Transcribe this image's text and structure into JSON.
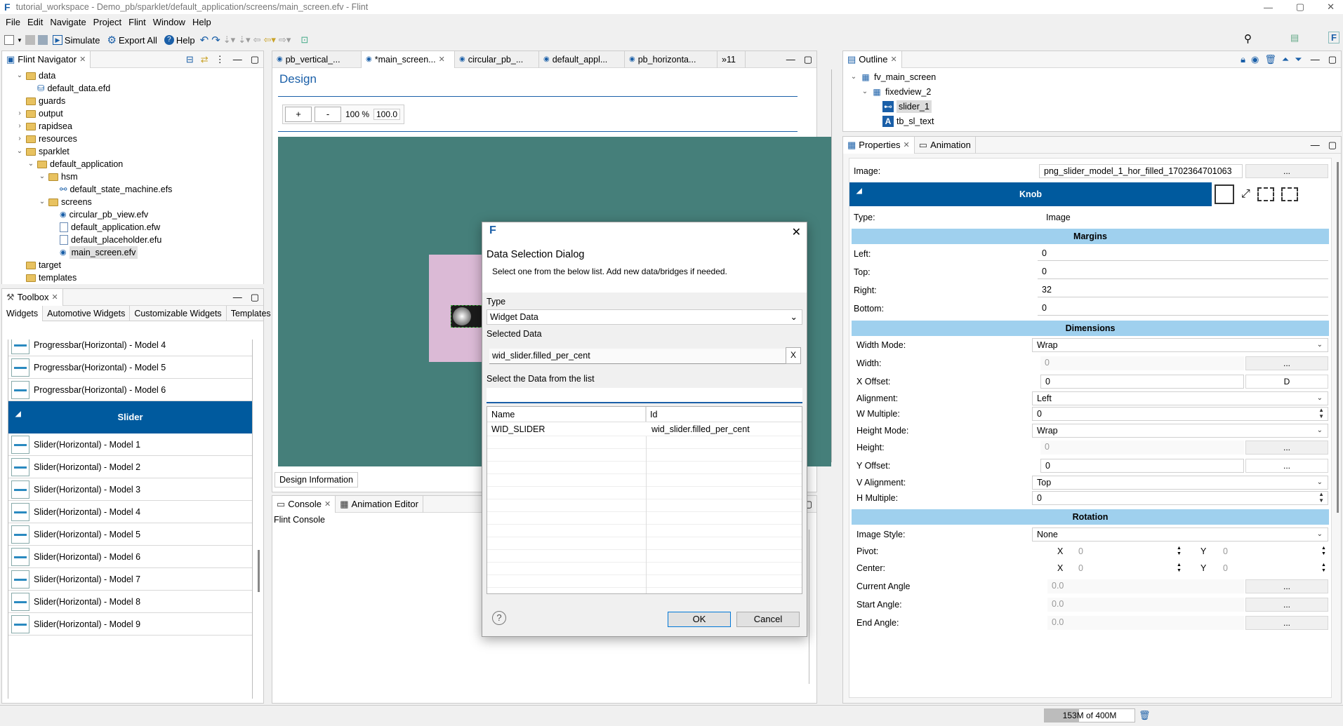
{
  "window": {
    "title": "tutorial_workspace - Demo_pb/sparklet/default_application/screens/main_screen.efv - Flint"
  },
  "menu": [
    "File",
    "Edit",
    "Navigate",
    "Project",
    "Flint",
    "Window",
    "Help"
  ],
  "toolbar": {
    "simulate": "Simulate",
    "export_all": "Export All",
    "help": "Help"
  },
  "navigator": {
    "title": "Flint Navigator",
    "items": [
      {
        "label": "data",
        "level": 1,
        "kind": "folder",
        "tw": "v"
      },
      {
        "label": "default_data.efd",
        "level": 2,
        "kind": "db",
        "tw": ""
      },
      {
        "label": "guards",
        "level": 1,
        "kind": "folder",
        "tw": ""
      },
      {
        "label": "output",
        "level": 1,
        "kind": "folder",
        "tw": ">"
      },
      {
        "label": "rapidsea",
        "level": 1,
        "kind": "folder",
        "tw": ">"
      },
      {
        "label": "resources",
        "level": 1,
        "kind": "folder",
        "tw": ">"
      },
      {
        "label": "sparklet",
        "level": 1,
        "kind": "folder",
        "tw": "v"
      },
      {
        "label": "default_application",
        "level": 2,
        "kind": "folder",
        "tw": "v"
      },
      {
        "label": "hsm",
        "level": 3,
        "kind": "folder",
        "tw": "v"
      },
      {
        "label": "default_state_machine.efs",
        "level": 4,
        "kind": "hsm",
        "tw": ""
      },
      {
        "label": "screens",
        "level": 3,
        "kind": "folder",
        "tw": "v"
      },
      {
        "label": "circular_pb_view.efv",
        "level": 4,
        "kind": "eye",
        "tw": ""
      },
      {
        "label": "default_application.efw",
        "level": 4,
        "kind": "file",
        "tw": ""
      },
      {
        "label": "default_placeholder.efu",
        "level": 4,
        "kind": "file",
        "tw": ""
      },
      {
        "label": "main_screen.efv",
        "level": 4,
        "kind": "eye",
        "tw": "",
        "selected": true
      },
      {
        "label": "target",
        "level": 1,
        "kind": "folder",
        "tw": ""
      },
      {
        "label": "templates",
        "level": 1,
        "kind": "folder",
        "tw": ""
      }
    ]
  },
  "toolbox": {
    "title": "Toolbox",
    "tabs": [
      "Widgets",
      "Automotive Widgets",
      "Customizable Widgets",
      "Templates"
    ],
    "items_top": [
      "Progressbar(Horizontal) - Model 4",
      "Progressbar(Horizontal) - Model 5",
      "Progressbar(Horizontal) - Model 6"
    ],
    "section": "Slider",
    "items": [
      "Slider(Horizontal) - Model 1",
      "Slider(Horizontal) - Model 2",
      "Slider(Horizontal) - Model 3",
      "Slider(Horizontal) - Model 4",
      "Slider(Horizontal) - Model 5",
      "Slider(Horizontal) - Model 6",
      "Slider(Horizontal) - Model 7",
      "Slider(Horizontal) - Model 8",
      "Slider(Horizontal) - Model 9"
    ]
  },
  "editor": {
    "tabs": [
      "pb_vertical_...",
      "*main_screen...",
      "circular_pb_...",
      "default_appl...",
      "pb_horizonta...",
      "»11"
    ],
    "design_title": "Design",
    "zoom_in": "+",
    "zoom_out": "-",
    "zoom_pct": "100 %",
    "zoom_value": "100.0",
    "bottom_tab": "Design Information"
  },
  "console": {
    "tabs": [
      "Console",
      "Animation Editor"
    ],
    "label": "Flint Console"
  },
  "outline": {
    "title": "Outline",
    "items": [
      {
        "label": "fv_main_screen",
        "level": 0
      },
      {
        "label": "fixedview_2",
        "level": 1
      },
      {
        "label": "slider_1",
        "level": 2,
        "selected": true
      },
      {
        "label": "tb_sl_text",
        "level": 2
      }
    ]
  },
  "properties": {
    "tabs": [
      "Properties",
      "Animation"
    ],
    "image_label": "Image:",
    "image_value": "png_slider_model_1_hor_filled_1702364701063",
    "ellipsis": "...",
    "knob": "Knob",
    "type_label": "Type:",
    "type_value": "Image",
    "margins": {
      "title": "Margins",
      "rows": [
        {
          "label": "Left:",
          "value": "0"
        },
        {
          "label": "Top:",
          "value": "0"
        },
        {
          "label": "Right:",
          "value": "32"
        },
        {
          "label": "Bottom:",
          "value": "0"
        }
      ]
    },
    "dimensions": {
      "title": "Dimensions",
      "width_mode": "Width Mode:",
      "width_mode_v": "Wrap",
      "width": "Width:",
      "width_v": "0",
      "x_offset": "X Offset:",
      "x_offset_v": "0",
      "x_offset_btn": "D",
      "alignment": "Alignment:",
      "alignment_v": "Left",
      "w_multiple": "W Multiple:",
      "w_multiple_v": "0",
      "height_mode": "Height Mode:",
      "height_mode_v": "Wrap",
      "height": "Height:",
      "height_v": "0",
      "y_offset": "Y Offset:",
      "y_offset_v": "0",
      "v_alignment": "V Alignment:",
      "v_alignment_v": "Top",
      "h_multiple": "H Multiple:",
      "h_multiple_v": "0"
    },
    "rotation": {
      "title": "Rotation",
      "image_style": "Image Style:",
      "image_style_v": "None",
      "pivot": "Pivot:",
      "center": "Center:",
      "x": "X",
      "y": "Y",
      "zero": "0",
      "current_angle": "Current Angle",
      "start_angle": "Start Angle:",
      "end_angle": "End Angle:",
      "angle_v": "0.0"
    }
  },
  "status": {
    "memory": "153M of 400M"
  },
  "dialog": {
    "title": "Data Selection Dialog",
    "subtitle": "Select one from the below list. Add new data/bridges if needed.",
    "type_label": "Type",
    "type_value": "Widget Data",
    "selected_label": "Selected Data",
    "selected_value": "wid_slider.filled_per_cent",
    "clear": "X",
    "list_label": "Select the Data from the list",
    "col_name": "Name",
    "col_id": "Id",
    "rows": [
      {
        "name": "WID_SLIDER",
        "id": "wid_slider.filled_per_cent"
      }
    ],
    "ok": "OK",
    "cancel": "Cancel"
  },
  "colors": {
    "accent": "#005a9e",
    "section": "#9fd0ee",
    "canvas": "#457f7a",
    "widget_bg": "#dbbad6"
  }
}
